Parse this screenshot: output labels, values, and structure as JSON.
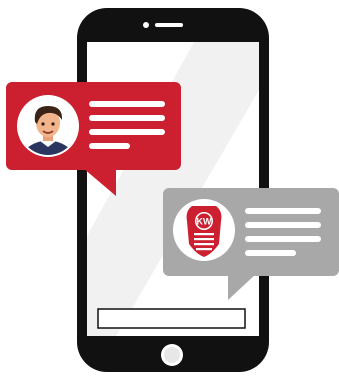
{
  "colors": {
    "phone_body": "#111111",
    "screen": "#ffffff",
    "screen_glare": "#f1f1f1",
    "bubble_user": "#cc1f2f",
    "bubble_brand": "#a8a8a8",
    "text_lines": "#ffffff",
    "home_button": "#e7e7e7",
    "avatar_bg": "#ffffff",
    "logo_bg": "#ffffff"
  },
  "icons": {
    "user_avatar": "person-avatar-icon",
    "brand_logo": "kenworth-kw-logo-icon",
    "speaker": "speaker-icon",
    "camera": "camera-icon",
    "home_button": "home-button-icon"
  },
  "brand_logo": {
    "letters": "KW"
  },
  "chat": {
    "user_message_lines": 4,
    "brand_message_lines": 4
  }
}
